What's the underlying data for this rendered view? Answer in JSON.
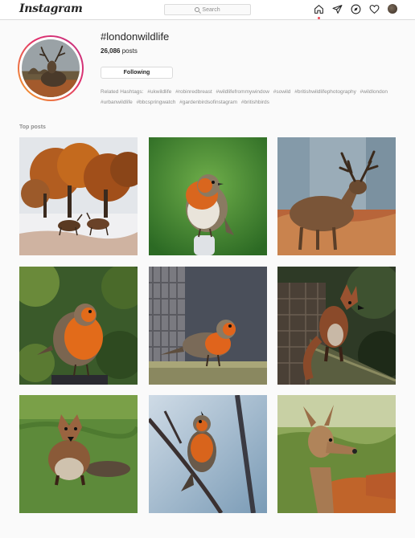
{
  "nav": {
    "logo": "Instagram",
    "search_placeholder": "Search",
    "icons": [
      "home-icon",
      "direct-icon",
      "explore-icon",
      "heart-icon",
      "profile-avatar"
    ]
  },
  "header": {
    "hashtag": "#londonwildlife",
    "post_count": "26,086",
    "post_label": "posts",
    "follow_button": "Following",
    "related_label": "Related Hashtags:",
    "related": [
      "#ukwildlife",
      "#robinredbreast",
      "#wildlifefrommywindow",
      "#sowild",
      "#britishwildlifephotography",
      "#wildlondon",
      "#urbanwildlife",
      "#bbcspringwatch",
      "#gardenbirdsofinstagram",
      "#britishbirds"
    ]
  },
  "section": {
    "top_posts": "Top posts"
  },
  "colors": {
    "ring_start": "#f5a623",
    "ring_end": "#c13584",
    "text": "#262626",
    "muted": "#8e8e8e",
    "notification": "#ed4956"
  },
  "posts": [
    {
      "subject": "deer-stags-autumn-trees"
    },
    {
      "subject": "robin-green-background"
    },
    {
      "subject": "red-deer-stag-bracken"
    },
    {
      "subject": "robin-leafy-background"
    },
    {
      "subject": "robin-fence-wood"
    },
    {
      "subject": "fox-on-brick-wall"
    },
    {
      "subject": "fox-on-grass"
    },
    {
      "subject": "robin-on-branch"
    },
    {
      "subject": "deer-hind-bracken"
    }
  ]
}
